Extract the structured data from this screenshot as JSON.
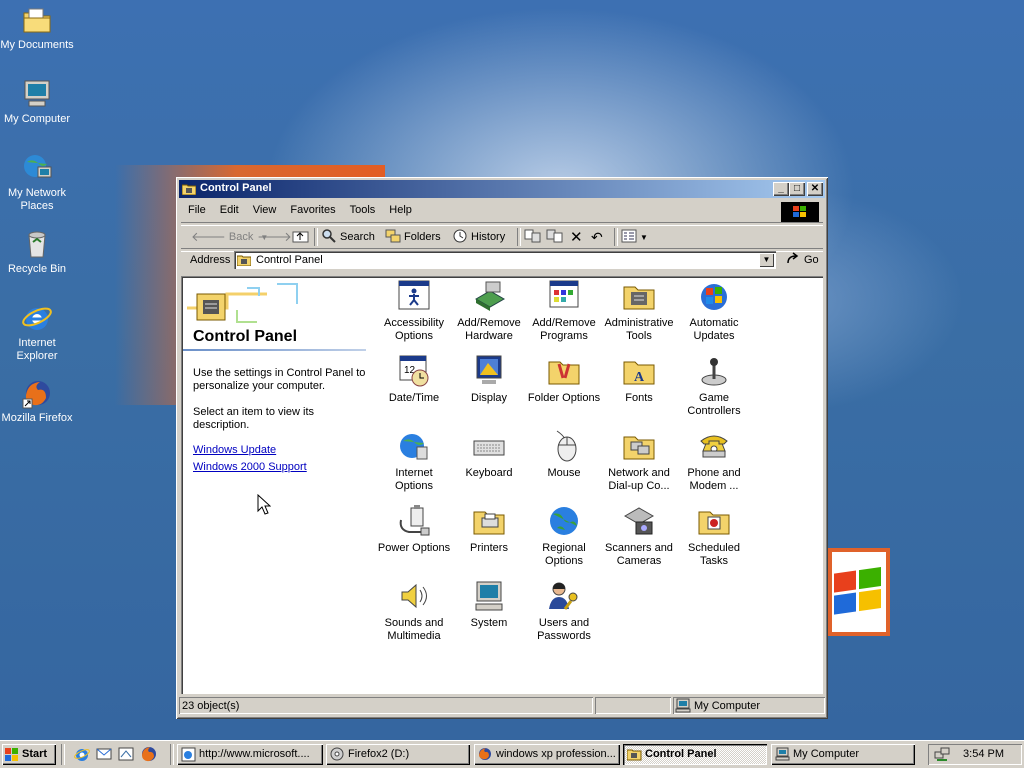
{
  "desktop": {
    "icons": [
      {
        "label": "My Documents",
        "icon": "folder-documents-icon"
      },
      {
        "label": "My Computer",
        "icon": "computer-icon"
      },
      {
        "label_line1": "My Network",
        "label_line2": "Places",
        "icon": "network-places-icon"
      },
      {
        "label": "Recycle Bin",
        "icon": "recycle-bin-icon"
      },
      {
        "label_line1": "Internet",
        "label_line2": "Explorer",
        "icon": "internet-explorer-icon"
      },
      {
        "label": "Mozilla Firefox",
        "icon": "firefox-icon"
      }
    ]
  },
  "window": {
    "title": "Control Panel",
    "menu": [
      "File",
      "Edit",
      "View",
      "Favorites",
      "Tools",
      "Help"
    ],
    "toolbar": {
      "back": "Back",
      "search": "Search",
      "folders": "Folders",
      "history": "History"
    },
    "address": {
      "label": "Address",
      "value": "Control Panel",
      "go": "Go"
    },
    "left_pane": {
      "title": "Control Panel",
      "desc1": "Use the settings in Control Panel to personalize your computer.",
      "desc2": "Select an item to view its description.",
      "link1": "Windows Update",
      "link2": "Windows 2000 Support"
    },
    "items": [
      {
        "l1": "Accessibility",
        "l2": "Options"
      },
      {
        "l1": "Add/Remove",
        "l2": "Hardware"
      },
      {
        "l1": "Add/Remove",
        "l2": "Programs"
      },
      {
        "l1": "Administrative",
        "l2": "Tools"
      },
      {
        "l1": "Automatic",
        "l2": "Updates"
      },
      {
        "l1": "Date/Time",
        "l2": ""
      },
      {
        "l1": "Display",
        "l2": ""
      },
      {
        "l1": "Folder Options",
        "l2": ""
      },
      {
        "l1": "Fonts",
        "l2": ""
      },
      {
        "l1": "Game",
        "l2": "Controllers"
      },
      {
        "l1": "Internet",
        "l2": "Options"
      },
      {
        "l1": "Keyboard",
        "l2": ""
      },
      {
        "l1": "Mouse",
        "l2": ""
      },
      {
        "l1": "Network and",
        "l2": "Dial-up Co..."
      },
      {
        "l1": "Phone and",
        "l2": "Modem ..."
      },
      {
        "l1": "Power Options",
        "l2": ""
      },
      {
        "l1": "Printers",
        "l2": ""
      },
      {
        "l1": "Regional",
        "l2": "Options"
      },
      {
        "l1": "Scanners and",
        "l2": "Cameras"
      },
      {
        "l1": "Scheduled",
        "l2": "Tasks"
      },
      {
        "l1": "Sounds and",
        "l2": "Multimedia"
      },
      {
        "l1": "System",
        "l2": ""
      },
      {
        "l1": "Users and",
        "l2": "Passwords"
      }
    ],
    "status": {
      "count": "23 object(s)",
      "zone": "My Computer"
    }
  },
  "taskbar": {
    "start": "Start",
    "tasks": [
      "http://www.microsoft....",
      "Firefox2 (D:)",
      "windows xp profession...",
      "Control Panel",
      "My Computer"
    ],
    "clock": "3:54 PM"
  },
  "colors": {
    "desktop": "#3a6ea5",
    "titlebar_start": "#0a246a",
    "titlebar_end": "#a6caf0",
    "face": "#d4d0c8",
    "link": "#0000c0"
  }
}
